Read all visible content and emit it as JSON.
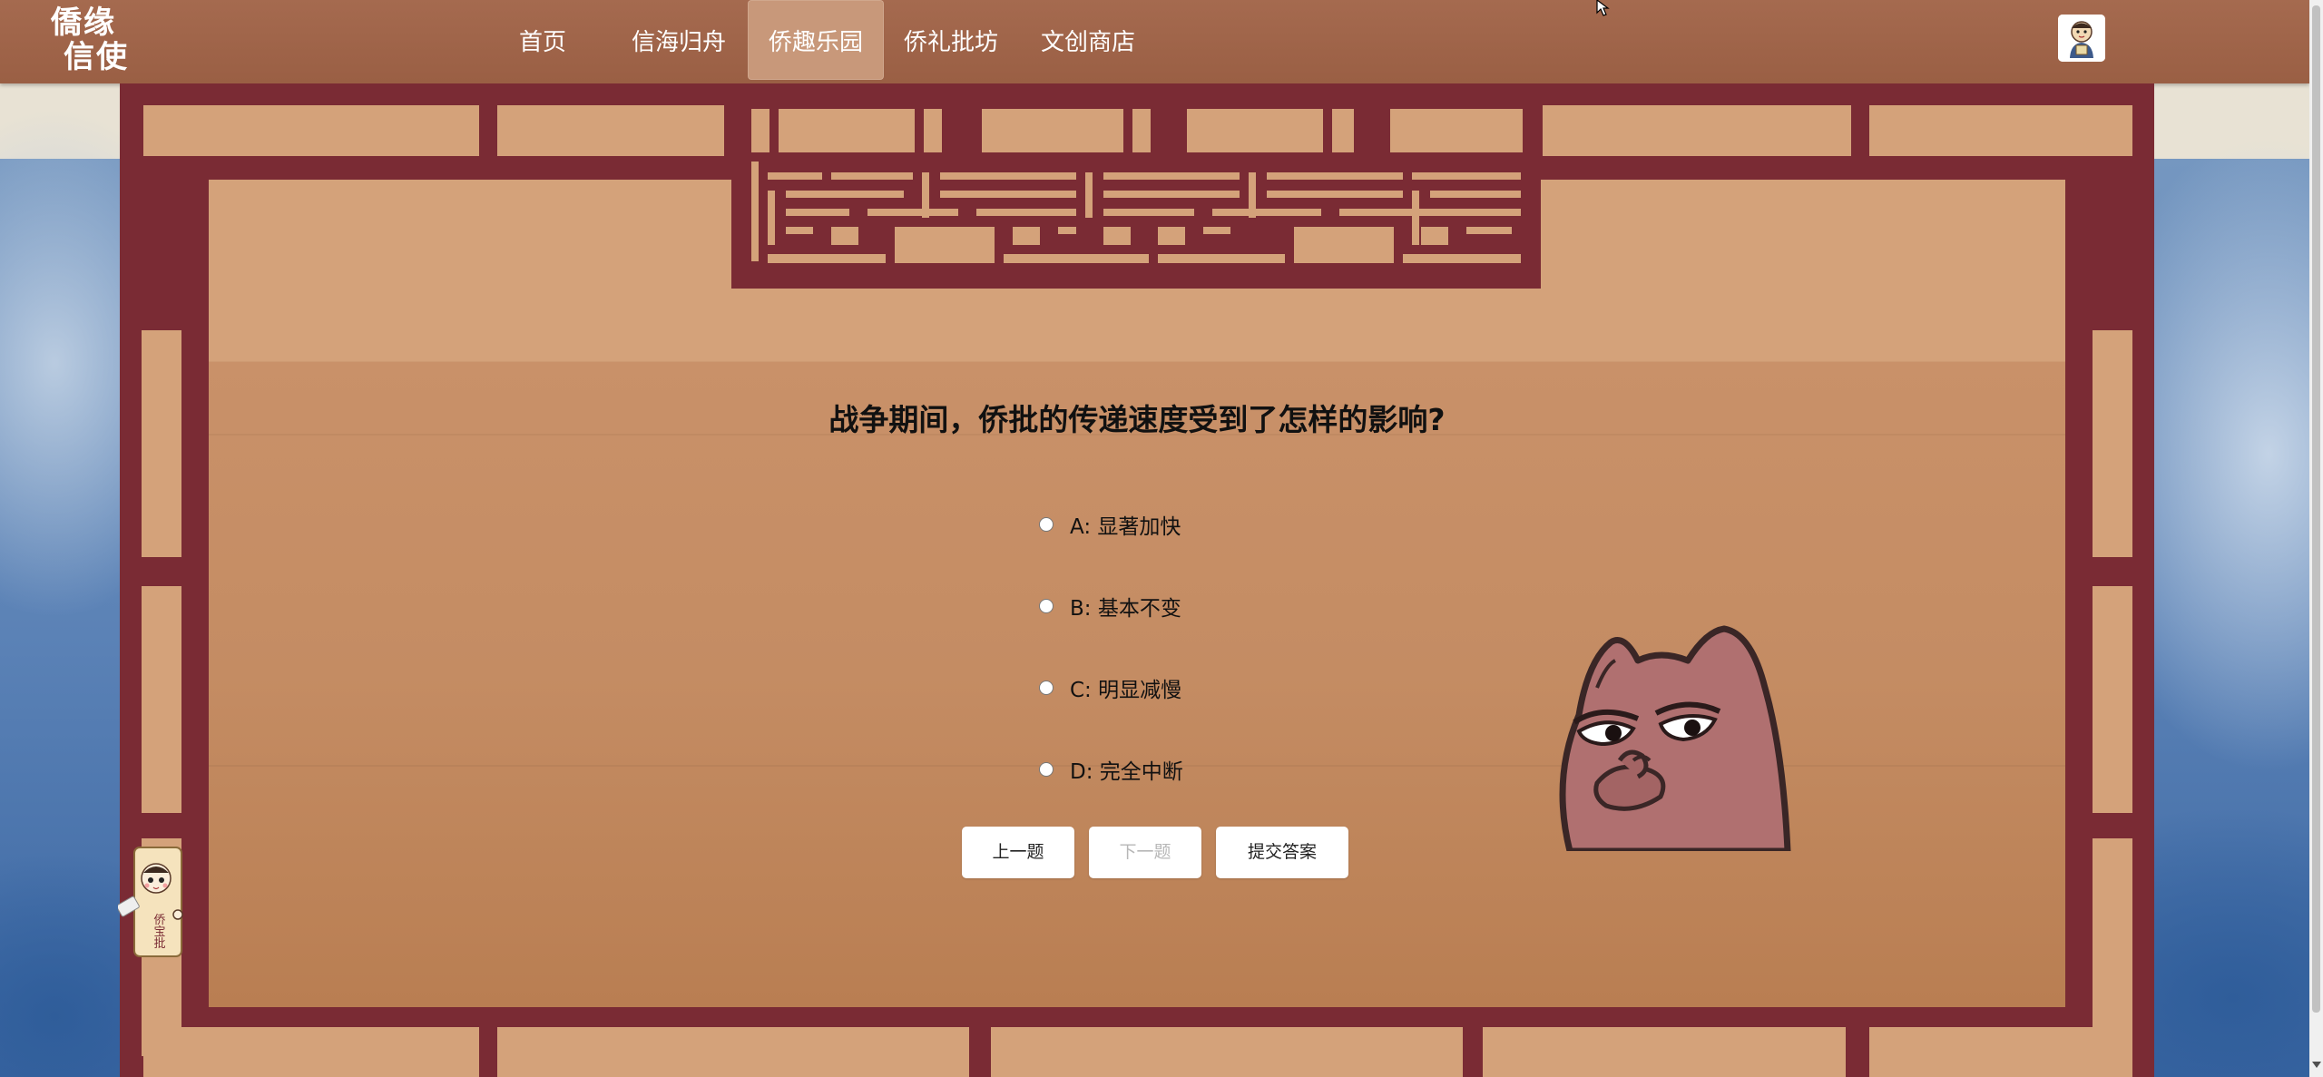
{
  "nav": {
    "logo_line1": "僑缘",
    "logo_line2": "信使",
    "items": [
      {
        "label": "首页"
      },
      {
        "label": "信海归舟"
      },
      {
        "label": "侨趣乐园"
      },
      {
        "label": "侨礼批坊"
      },
      {
        "label": "文创商店"
      }
    ],
    "active_index": 2
  },
  "quiz": {
    "question": "战争期间，侨批的传递速度受到了怎样的影响?",
    "options": [
      {
        "label": "A: 显著加快"
      },
      {
        "label": "B: 基本不变"
      },
      {
        "label": "C: 明显减慢"
      },
      {
        "label": "D: 完全中断"
      }
    ],
    "buttons": {
      "prev": "上一题",
      "next": "下一题",
      "submit": "提交答案"
    }
  },
  "mascot": {
    "scroll_text": "侨宝批"
  },
  "colors": {
    "nav_bg": "#a56a4f",
    "nav_active": "#c8987a",
    "frame": "#7a2b34",
    "panel": "#d4a27a"
  }
}
